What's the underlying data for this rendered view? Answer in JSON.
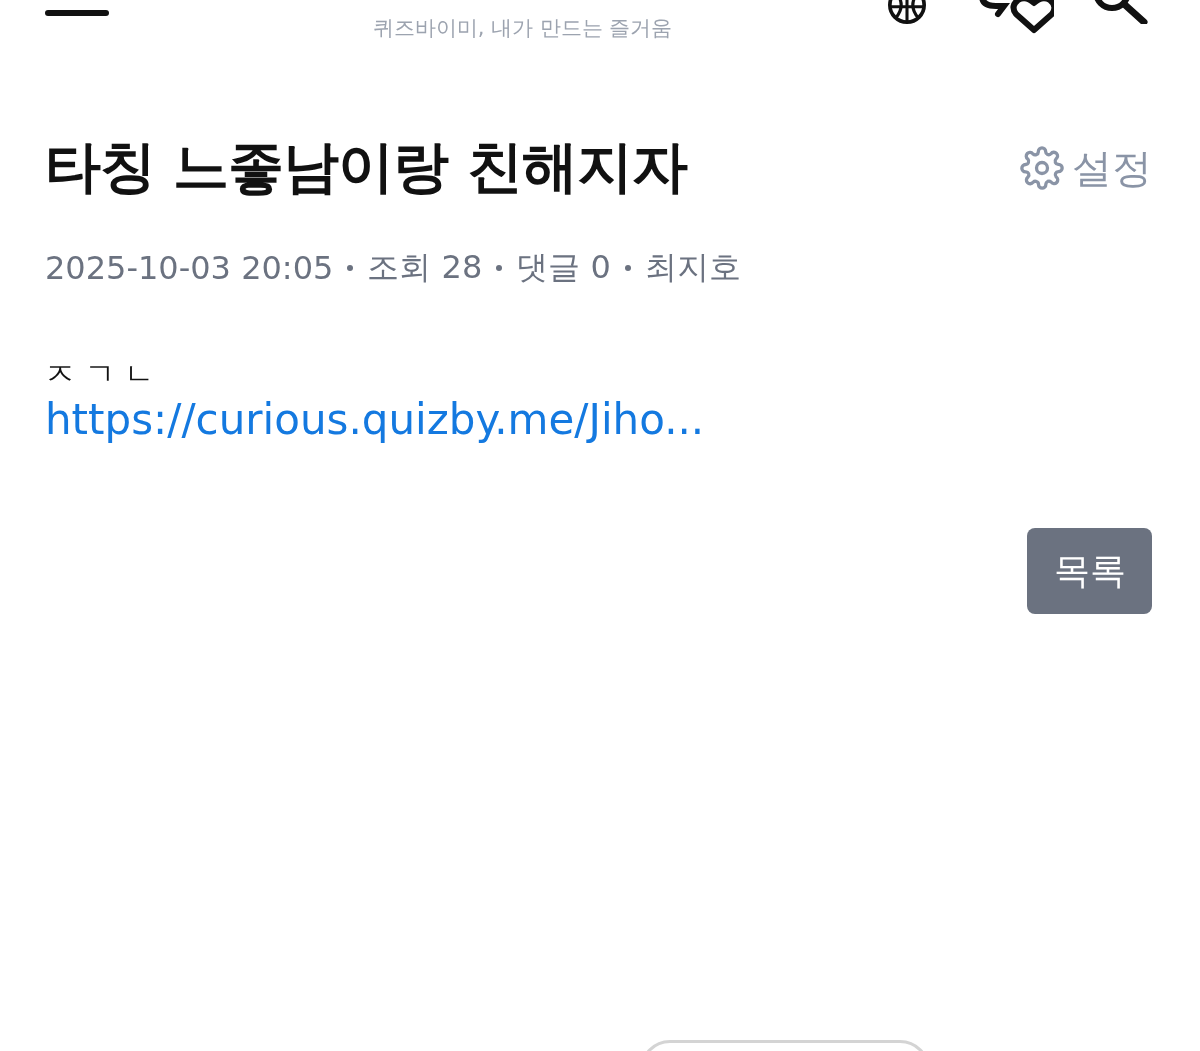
{
  "header": {
    "tagline": "퀴즈바이미, 내가 만드는 즐거움"
  },
  "post": {
    "title": "타칭 느좋남이랑 친해지자",
    "settings_label": "설정",
    "meta": [
      "2025-10-03 20:05",
      "조회 28",
      "댓글 0",
      "최지호"
    ],
    "body": "ㅈ ㄱ ㄴ",
    "link": "https://curious.quizby.me/Jiho..."
  },
  "list_button": "목록"
}
